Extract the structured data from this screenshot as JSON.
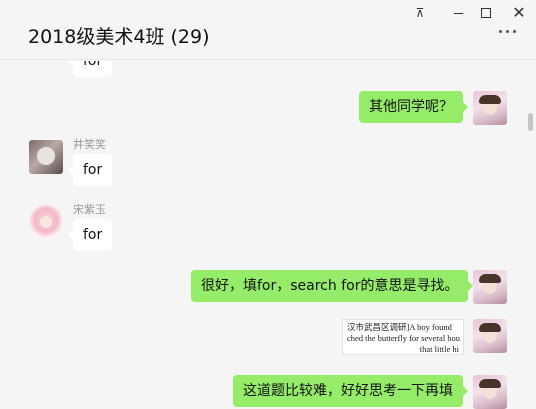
{
  "window": {
    "title": "2018级美术4班 (29)",
    "controls": {
      "pin": "⊼",
      "close": "✕"
    }
  },
  "messages": [
    {
      "id": "m0",
      "side": "in",
      "text": "for",
      "partial": true
    },
    {
      "id": "m1",
      "side": "out",
      "text": "其他同学呢？"
    },
    {
      "id": "m2",
      "side": "in",
      "sender": "井笑笑",
      "text": "for"
    },
    {
      "id": "m3",
      "side": "in",
      "sender": "宋紫玉",
      "text": "for"
    },
    {
      "id": "m4",
      "side": "out",
      "text": "很好，填for，search for的意思是寻找。"
    },
    {
      "id": "m5",
      "side": "out",
      "type": "image",
      "lines": [
        "汉市武昌区调研]A boy found",
        "ched the butterfly for several hou",
        "that little hi"
      ]
    },
    {
      "id": "m6",
      "side": "out",
      "text": "这道题比较难，好好思考一下再填"
    }
  ],
  "colors": {
    "outgoing_bubble": "#95ec69",
    "incoming_bubble": "#ffffff",
    "background": "#f5f5f5"
  }
}
